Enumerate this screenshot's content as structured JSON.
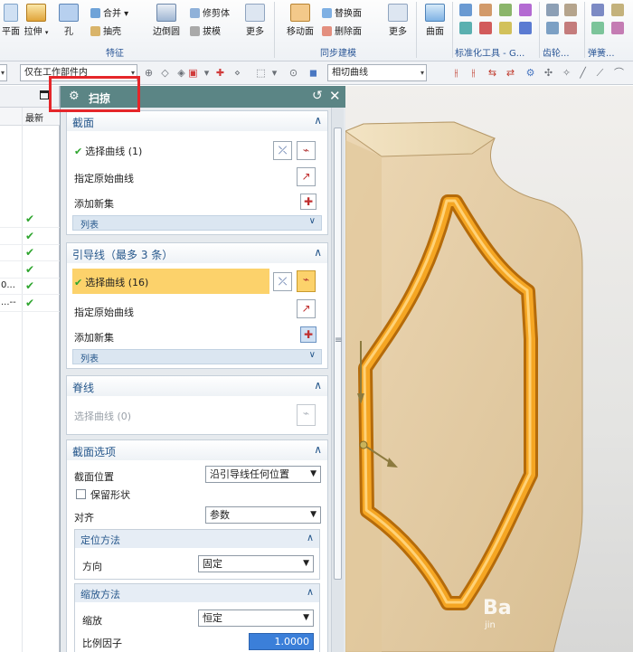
{
  "ribbon": {
    "buttons": {
      "plane": "平面",
      "extrude": "拉伸",
      "hole": "孔",
      "edge_blend": "边倒圆",
      "more1": "更多",
      "move_face": "移动面",
      "more2": "更多",
      "surface": "曲面"
    },
    "small_buttons": {
      "unite": "合并",
      "shell": "抽壳",
      "trim_body": "修剪体",
      "draft": "拔模",
      "replace_face": "替换面",
      "delete_face": "删除面"
    },
    "groups": {
      "feature": "特征",
      "sync_modeling": "同步建模",
      "std_tools": "标准化工具 - G...",
      "gear": "齿轮...",
      "spring": "弹簧..."
    }
  },
  "toolbar": {
    "filter_scope": "仅在工作部件内",
    "curve_rule": "相切曲线"
  },
  "navigator": {
    "col_latest": "最新",
    "rows": [
      {
        "text": "",
        "check": "✔"
      },
      {
        "text": "",
        "check": "✔"
      },
      {
        "text": "",
        "check": "✔"
      },
      {
        "text": "",
        "check": "✔"
      },
      {
        "text": "0...",
        "check": "✔"
      },
      {
        "text": "...--",
        "check": "✔"
      }
    ]
  },
  "dialog": {
    "title": "扫掠",
    "section1": {
      "header": "截面",
      "select_curve": "选择曲线 (1)",
      "specify_origin": "指定原始曲线",
      "add_new_set": "添加新集",
      "list": "列表"
    },
    "section2": {
      "header": "引导线（最多 3 条）",
      "select_curve": "选择曲线 (16)",
      "specify_origin": "指定原始曲线",
      "add_new_set": "添加新集",
      "list": "列表"
    },
    "section3": {
      "header": "脊线",
      "select_curve": "选择曲线 (0)"
    },
    "section4": {
      "header": "截面选项",
      "section_location_label": "截面位置",
      "section_location_value": "沿引导线任何位置",
      "preserve_shape": "保留形状",
      "alignment_label": "对齐",
      "alignment_value": "参数",
      "orientation_header": "定位方法",
      "direction_label": "方向",
      "direction_value": "固定",
      "scaling_header": "缩放方法",
      "scale_label": "缩放",
      "scale_value": "恒定",
      "scale_factor_label": "比例因子",
      "scale_factor_value": "1.0000"
    }
  },
  "watermark": {
    "brand": "Ba",
    "sub": "jin"
  },
  "colors": {
    "dialog_title_bg": "#5b8585",
    "highlight": "#fcd26b",
    "check_green": "#2fa52f",
    "red_box": "#e5262a",
    "sweep_orange": "#f0a020"
  }
}
